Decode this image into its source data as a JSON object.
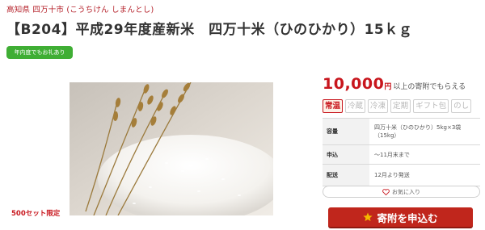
{
  "breadcrumb": "高知県 四万十市 (こうちけん しまんとし)",
  "title": "【B204】平成29年度産新米　四万十米（ひのひかり）15ｋｇ",
  "badge": "年内度でもお礼あり",
  "limited_text": "500セット限定",
  "price": {
    "amount": "10,000",
    "unit": "円",
    "note": "以上の寄附でもらえる"
  },
  "tags": [
    "常温",
    "冷蔵",
    "冷凍",
    "定期",
    "ギフト包",
    "のし"
  ],
  "info": {
    "rows": [
      {
        "key": "容量",
        "value_lines": [
          "四万十米（ひのひかり）5kg×3袋",
          "（15kg）"
        ]
      },
      {
        "key": "申込",
        "value_lines": [
          "～11月末まで"
        ]
      },
      {
        "key": "配送",
        "value_lines": [
          "12月より発送"
        ]
      }
    ]
  },
  "favorite_label": "お気に入り",
  "apply_label": "寄附を申込む",
  "icons": {
    "favorite": "heart-icon",
    "apply": "star-icon"
  },
  "colors": {
    "accent": "#c8161d",
    "badge": "#3fae34",
    "button": "#c0261c"
  }
}
